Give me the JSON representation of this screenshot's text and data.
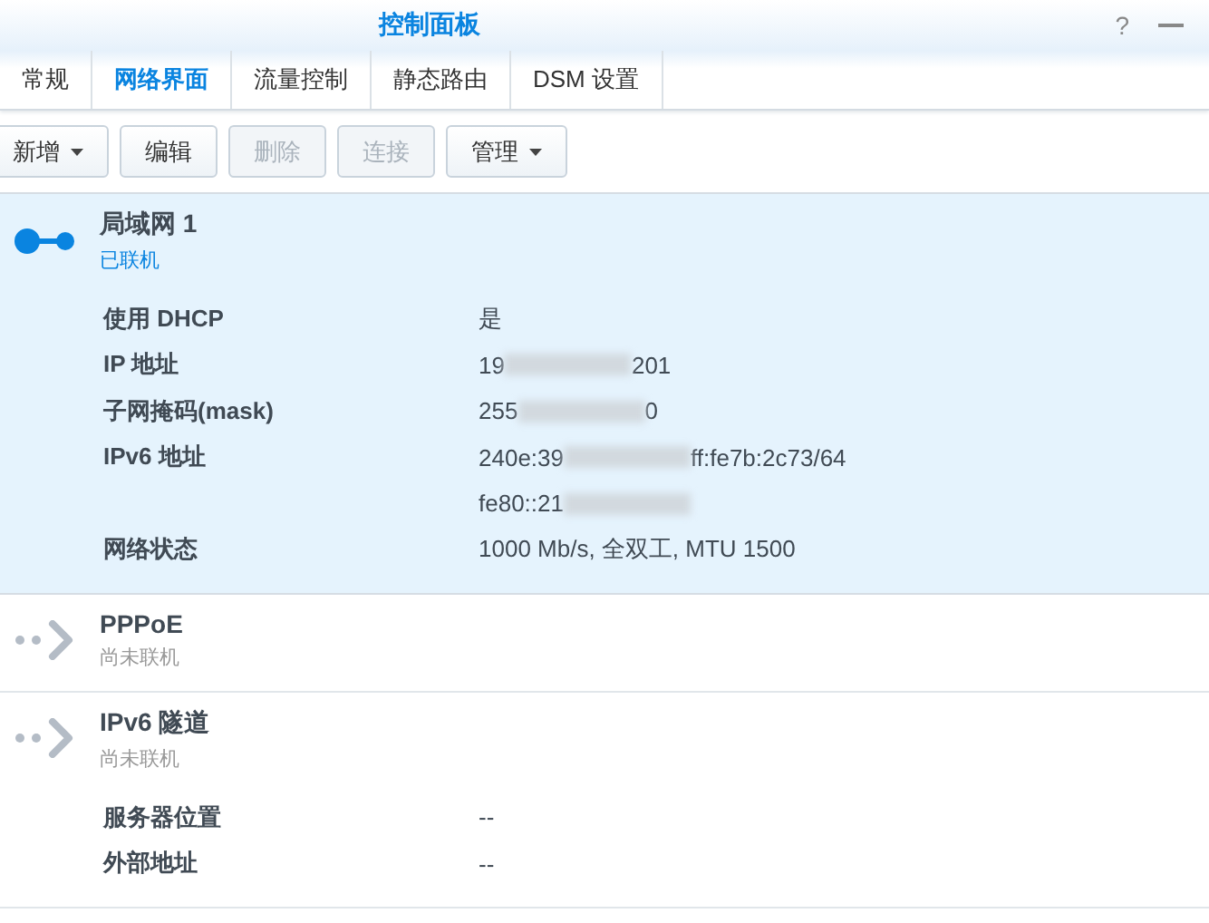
{
  "window": {
    "title": "控制面板",
    "help": "?"
  },
  "tabs": [
    {
      "label": "常规",
      "selected": false
    },
    {
      "label": "网络界面",
      "selected": true
    },
    {
      "label": "流量控制",
      "selected": false
    },
    {
      "label": "静态路由",
      "selected": false
    },
    {
      "label": "DSM 设置",
      "selected": false
    }
  ],
  "toolbar": [
    {
      "label": "新增",
      "dropdown": true,
      "disabled": false
    },
    {
      "label": "编辑",
      "dropdown": false,
      "disabled": false
    },
    {
      "label": "删除",
      "dropdown": false,
      "disabled": true
    },
    {
      "label": "连接",
      "dropdown": false,
      "disabled": true
    },
    {
      "label": "管理",
      "dropdown": true,
      "disabled": false
    }
  ],
  "interfaces": [
    {
      "name": "局域网 1",
      "status": "已联机",
      "connected": true,
      "selected": true,
      "details": [
        {
          "label": "使用 DHCP",
          "value": [
            "是"
          ]
        },
        {
          "label": "IP 地址",
          "value": [
            "19",
            "201"
          ]
        },
        {
          "label": "子网掩码(mask)",
          "value": [
            "255",
            "0"
          ]
        },
        {
          "label": "IPv6 地址",
          "value": [
            "240e:39",
            "ff:fe7b:2c73/64"
          ]
        },
        {
          "value": [
            "fe80::21"
          ],
          "tail_hidden": true
        },
        {
          "label": "网络状态",
          "value": [
            "1000 Mb/s, 全双工, MTU 1500"
          ]
        }
      ]
    },
    {
      "name": "PPPoE",
      "status": "尚未联机",
      "connected": false,
      "selected": false
    },
    {
      "name": "IPv6 隧道",
      "status": "尚未联机",
      "connected": false,
      "selected": false,
      "details": [
        {
          "label": "服务器位置",
          "value": [
            "--"
          ]
        },
        {
          "label": "外部地址",
          "value": [
            "--"
          ]
        }
      ]
    }
  ]
}
